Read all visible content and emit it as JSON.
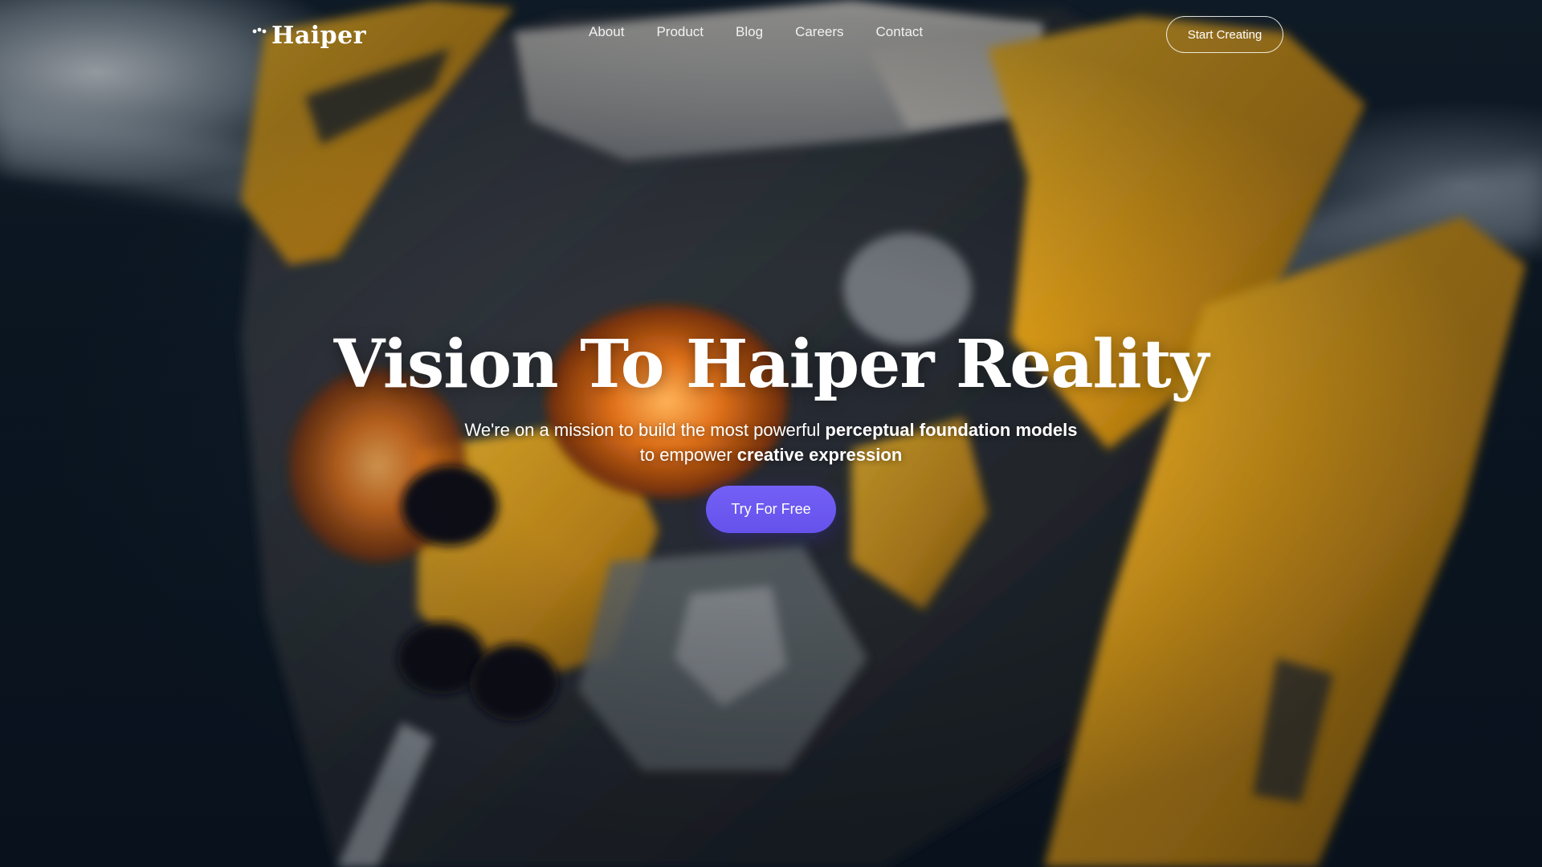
{
  "brand": {
    "name": "Haiper"
  },
  "nav": {
    "links": [
      {
        "label": "About"
      },
      {
        "label": "Product"
      },
      {
        "label": "Blog"
      },
      {
        "label": "Careers"
      },
      {
        "label": "Contact"
      }
    ],
    "cta_label": "Start Creating"
  },
  "hero": {
    "title": "Vision To Haiper Reality",
    "subtitle_line1_plain": "We're on a mission to build the most powerful ",
    "subtitle_line1_bold": "perceptual foundation models",
    "subtitle_line2_plain": "to empower ",
    "subtitle_line2_bold": "creative expression",
    "cta_label": "Try For Free",
    "background_image": "robot-head-yellow-armor"
  },
  "colors": {
    "accent": "#6c5ce7",
    "text": "#ffffff",
    "robot_yellow": "#e0a21f",
    "background_dark": "#0e1b28"
  }
}
